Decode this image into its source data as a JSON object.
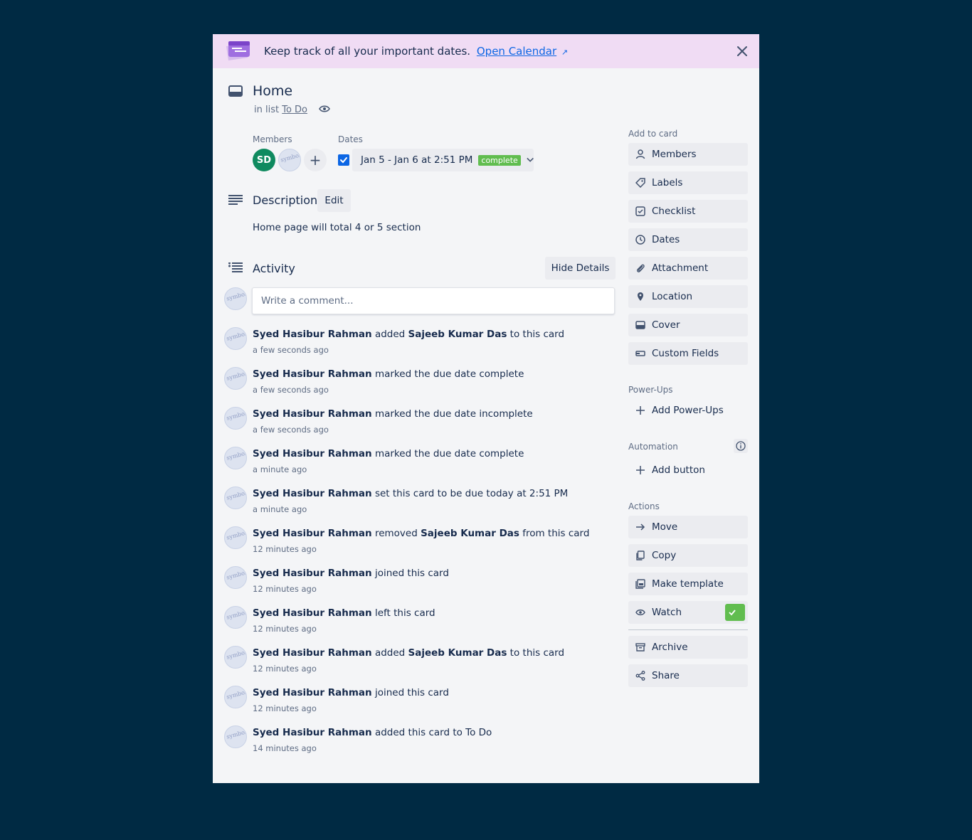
{
  "banner": {
    "text": "Keep track of all your important dates.",
    "link": "Open Calendar",
    "accent": "#f0dcf4"
  },
  "card": {
    "title": "Home",
    "in_list_prefix": "in list",
    "list_name": "To Do"
  },
  "members": {
    "label": "Members",
    "initials": "SD"
  },
  "dates": {
    "label": "Dates",
    "value": "Jan 5 - Jan 6 at 2:51 PM",
    "status": "complete",
    "status_color": "#61bd4f",
    "checked": true
  },
  "description": {
    "title": "Description",
    "edit_label": "Edit",
    "text": "Home page will total 4 or 5 section"
  },
  "activity": {
    "title": "Activity",
    "hide_label": "Hide Details",
    "comment_placeholder": "Write a comment...",
    "items": [
      {
        "user": "Syed Hasibur Rahman",
        "pre": " added ",
        "bold2": "Sajeeb Kumar Das",
        "post": " to this card",
        "time": "a few seconds ago"
      },
      {
        "user": "Syed Hasibur Rahman",
        "pre": " marked the due date complete",
        "bold2": "",
        "post": "",
        "time": "a few seconds ago"
      },
      {
        "user": "Syed Hasibur Rahman",
        "pre": " marked the due date incomplete",
        "bold2": "",
        "post": "",
        "time": "a few seconds ago"
      },
      {
        "user": "Syed Hasibur Rahman",
        "pre": " marked the due date complete",
        "bold2": "",
        "post": "",
        "time": "a minute ago"
      },
      {
        "user": "Syed Hasibur Rahman",
        "pre": " set this card to be due today at 2:51 PM",
        "bold2": "",
        "post": "",
        "time": "a minute ago"
      },
      {
        "user": "Syed Hasibur Rahman",
        "pre": " removed ",
        "bold2": "Sajeeb Kumar Das",
        "post": " from this card",
        "time": "12 minutes ago"
      },
      {
        "user": "Syed Hasibur Rahman",
        "pre": " joined this card",
        "bold2": "",
        "post": "",
        "time": "12 minutes ago"
      },
      {
        "user": "Syed Hasibur Rahman",
        "pre": " left this card",
        "bold2": "",
        "post": "",
        "time": "12 minutes ago"
      },
      {
        "user": "Syed Hasibur Rahman",
        "pre": " added ",
        "bold2": "Sajeeb Kumar Das",
        "post": " to this card",
        "time": "12 minutes ago"
      },
      {
        "user": "Syed Hasibur Rahman",
        "pre": " joined this card",
        "bold2": "",
        "post": "",
        "time": "12 minutes ago"
      },
      {
        "user": "Syed Hasibur Rahman",
        "pre": " added this card to To Do",
        "bold2": "",
        "post": "",
        "time": "14 minutes ago"
      }
    ]
  },
  "sidebar": {
    "add_to_card_label": "Add to card",
    "add_to_card": [
      "Members",
      "Labels",
      "Checklist",
      "Dates",
      "Attachment",
      "Location",
      "Cover",
      "Custom Fields"
    ],
    "powerups_label": "Power-Ups",
    "add_powerups": "Add Power-Ups",
    "automation_label": "Automation",
    "add_button": "Add button",
    "actions_label": "Actions",
    "actions": [
      "Move",
      "Copy",
      "Make template",
      "Watch"
    ],
    "actions2": [
      "Archive",
      "Share"
    ]
  },
  "colors": {
    "background": "#002a43",
    "panel": "#f4f5f7",
    "button": "#ebecf0",
    "watch_check": "#61bd4f"
  }
}
